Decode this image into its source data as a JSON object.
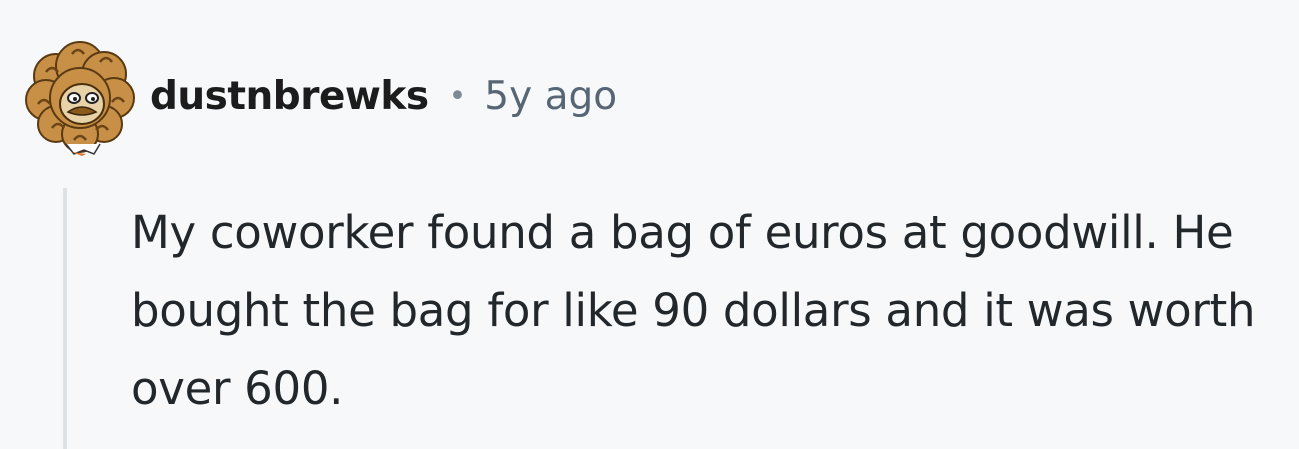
{
  "comment": {
    "author": "dustnbrewks",
    "separator": "•",
    "timestamp": "5y ago",
    "body": "My coworker found a bag of euros at goodwill. He bought the bag for like 90 dollars and it was worth over 600.",
    "avatar_icon": "curly-hair-avatar-icon"
  },
  "colors": {
    "background": "#f7f8fa",
    "author_text": "#1c1c1c",
    "timestamp_text": "#566675",
    "body_text": "#22272b",
    "thread_line": "#dde2e7",
    "avatar_hair": "#c89046"
  }
}
